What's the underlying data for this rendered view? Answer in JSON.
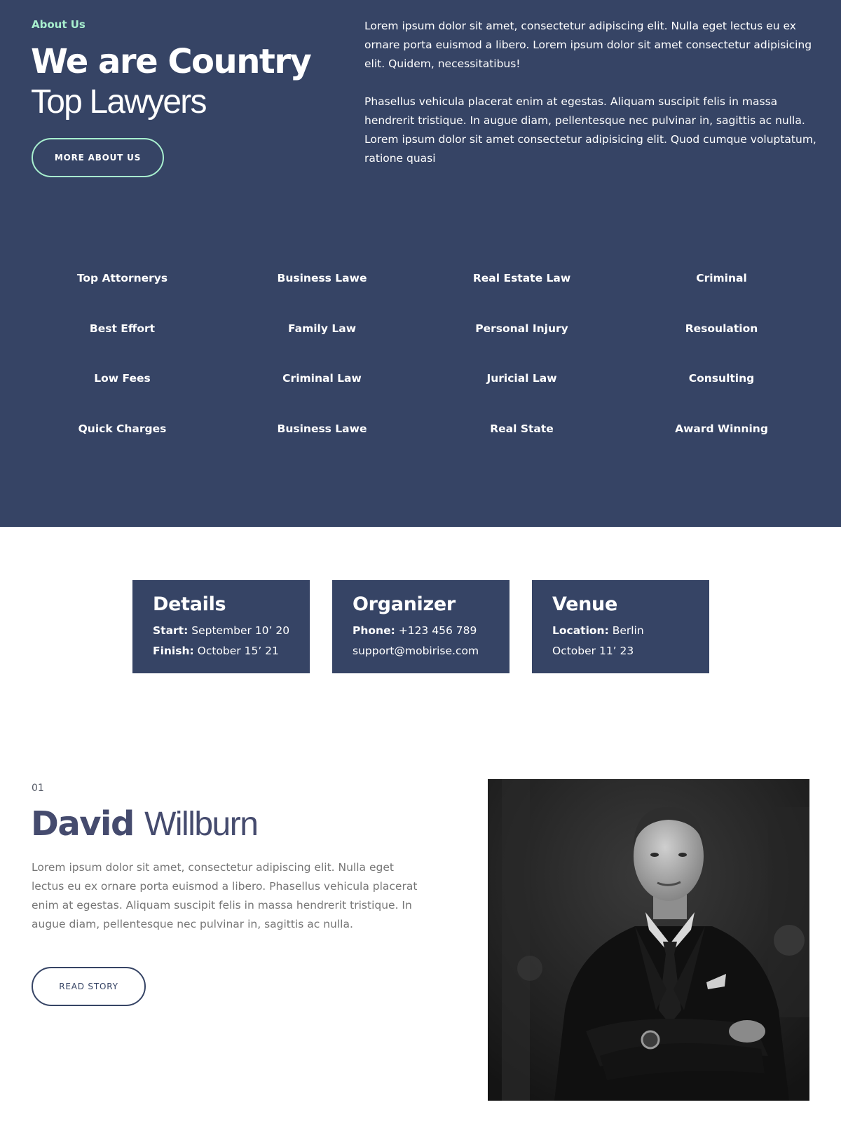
{
  "about": {
    "label": "About Us",
    "headline_strong": "We are Country",
    "headline_light": "Top Lawyers",
    "button_label": "MORE ABOUT US",
    "paragraphs": [
      "Lorem ipsum dolor sit amet, consectetur adipiscing elit. Nulla eget lectus eu ex ornare porta euismod a libero. Lorem ipsum dolor sit amet consectetur adipisicing elit. Quidem, necessitatibus!",
      "Phasellus vehicula placerat enim at egestas. Aliquam suscipit felis in massa hendrerit tristique. In augue diam, pellentesque nec pulvinar in, sagittis ac nulla. Lorem ipsum dolor sit amet consectetur adipisicing elit. Quod cumque voluptatum, ratione quasi"
    ],
    "services": [
      "Top Attornerys",
      "Business Lawe",
      "Real Estate Law",
      "Criminal",
      "Best Effort",
      "Family Law",
      "Personal Injury",
      "Resoulation",
      "Low Fees",
      "Criminal Law",
      "Juricial Law",
      "Consulting",
      "Quick Charges",
      "Business Lawe",
      "Real State",
      "Award Winning"
    ]
  },
  "cards": [
    {
      "title": "Details",
      "lines": [
        {
          "label": "Start:",
          "value": " September 10’ 20"
        },
        {
          "label": "Finish:",
          "value": " October 15’ 21"
        }
      ]
    },
    {
      "title": "Organizer",
      "lines": [
        {
          "label": "Phone:",
          "value": " +123 456 789"
        },
        {
          "label": "",
          "value": "support@mobirise.com"
        }
      ]
    },
    {
      "title": "Venue",
      "lines": [
        {
          "label": "Location:",
          "value": " Berlin"
        },
        {
          "label": "",
          "value": "October 11’ 23"
        }
      ]
    }
  ],
  "profile": {
    "number": "01",
    "first_name": "David",
    "last_name": "Willburn",
    "text": "Lorem ipsum dolor sit amet, consectetur adipiscing elit. Nulla eget lectus eu ex ornare porta euismod a libero. Phasellus vehicula placerat enim at egestas. Aliquam suscipit felis in massa hendrerit tristique. In augue diam, pellentesque nec pulvinar in, sagittis ac nulla.",
    "button_label": "READ STORY"
  },
  "colors": {
    "section_bg": "#364465",
    "accent": "#a8f0cf",
    "name_color": "#454b6e",
    "body_text_gray": "#767676"
  }
}
